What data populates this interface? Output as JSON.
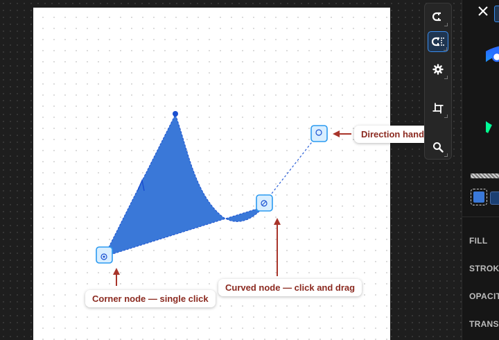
{
  "canvas": {
    "background": "#1e1e1e",
    "artboard_color": "#ffffff",
    "shape_fill": "#3a78d8",
    "path_color": "#1a4fd0",
    "node_color": "#2a9af0",
    "annotation_color": "#a8342a"
  },
  "callouts": {
    "direction_handle": "Direction handle",
    "curved_node": "Curved node — click and drag",
    "corner_node": "Corner node — single click"
  },
  "toolbar": {
    "tools": [
      {
        "icon": "snap-magnet-icon",
        "active": false
      },
      {
        "icon": "snap-grid-magnet-icon",
        "active": true
      },
      {
        "icon": "gear-icon",
        "active": false
      },
      {
        "icon": "crop-frame-icon",
        "active": false
      },
      {
        "icon": "zoom-icon",
        "active": false
      }
    ]
  },
  "panel": {
    "close_icon": "close-icon",
    "fill_color": "#3a78d8",
    "labels": {
      "fill": "FILL",
      "stroke": "STROKE",
      "opacity": "OPACITY",
      "transform": "TRANSFORM"
    }
  }
}
